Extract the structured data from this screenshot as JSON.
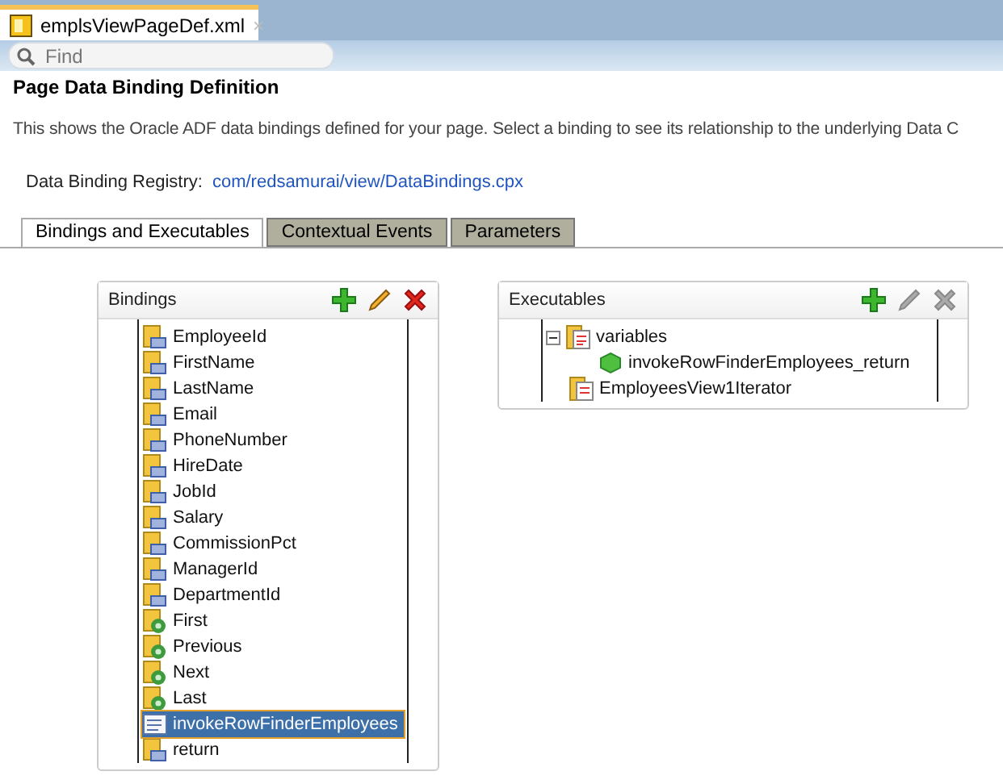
{
  "file_tab": {
    "title": "emplsViewPageDef.xml",
    "close": "×"
  },
  "search": {
    "placeholder": "Find"
  },
  "heading": "Page Data Binding Definition",
  "description": "This shows the Oracle ADF data bindings defined for your page. Select a binding to see its relationship to the underlying Data C",
  "registry": {
    "label": "Data Binding Registry:",
    "link": "com/redsamurai/view/DataBindings.cpx"
  },
  "tabs": [
    {
      "label": "Bindings and Executables",
      "selected": true
    },
    {
      "label": "Contextual Events",
      "selected": false
    },
    {
      "label": "Parameters",
      "selected": false
    }
  ],
  "bindings": {
    "title": "Bindings",
    "tools": [
      {
        "kind": "add",
        "disabled": false
      },
      {
        "kind": "edit",
        "disabled": false
      },
      {
        "kind": "delete",
        "disabled": false
      }
    ],
    "items": [
      {
        "label": "EmployeeId",
        "kind": "attribute",
        "selected": false
      },
      {
        "label": "FirstName",
        "kind": "attribute",
        "selected": false
      },
      {
        "label": "LastName",
        "kind": "attribute",
        "selected": false
      },
      {
        "label": "Email",
        "kind": "attribute",
        "selected": false
      },
      {
        "label": "PhoneNumber",
        "kind": "attribute",
        "selected": false
      },
      {
        "label": "HireDate",
        "kind": "attribute",
        "selected": false
      },
      {
        "label": "JobId",
        "kind": "attribute",
        "selected": false
      },
      {
        "label": "Salary",
        "kind": "attribute",
        "selected": false
      },
      {
        "label": "CommissionPct",
        "kind": "attribute",
        "selected": false
      },
      {
        "label": "ManagerId",
        "kind": "attribute",
        "selected": false
      },
      {
        "label": "DepartmentId",
        "kind": "attribute",
        "selected": false
      },
      {
        "label": "First",
        "kind": "action",
        "selected": false
      },
      {
        "label": "Previous",
        "kind": "action",
        "selected": false
      },
      {
        "label": "Next",
        "kind": "action",
        "selected": false
      },
      {
        "label": "Last",
        "kind": "action",
        "selected": false
      },
      {
        "label": "invokeRowFinderEmployees",
        "kind": "method",
        "selected": true
      },
      {
        "label": "return",
        "kind": "attribute",
        "selected": false
      }
    ]
  },
  "executables": {
    "title": "Executables",
    "tools": [
      {
        "kind": "add",
        "disabled": false
      },
      {
        "kind": "edit",
        "disabled": true
      },
      {
        "kind": "delete",
        "disabled": true
      }
    ],
    "items": [
      {
        "label": "variables",
        "kind": "variables",
        "expanded": true,
        "children": [
          {
            "label": "invokeRowFinderEmployees_return",
            "kind": "variable"
          }
        ]
      },
      {
        "label": "EmployeesView1Iterator",
        "kind": "iterator"
      }
    ]
  }
}
